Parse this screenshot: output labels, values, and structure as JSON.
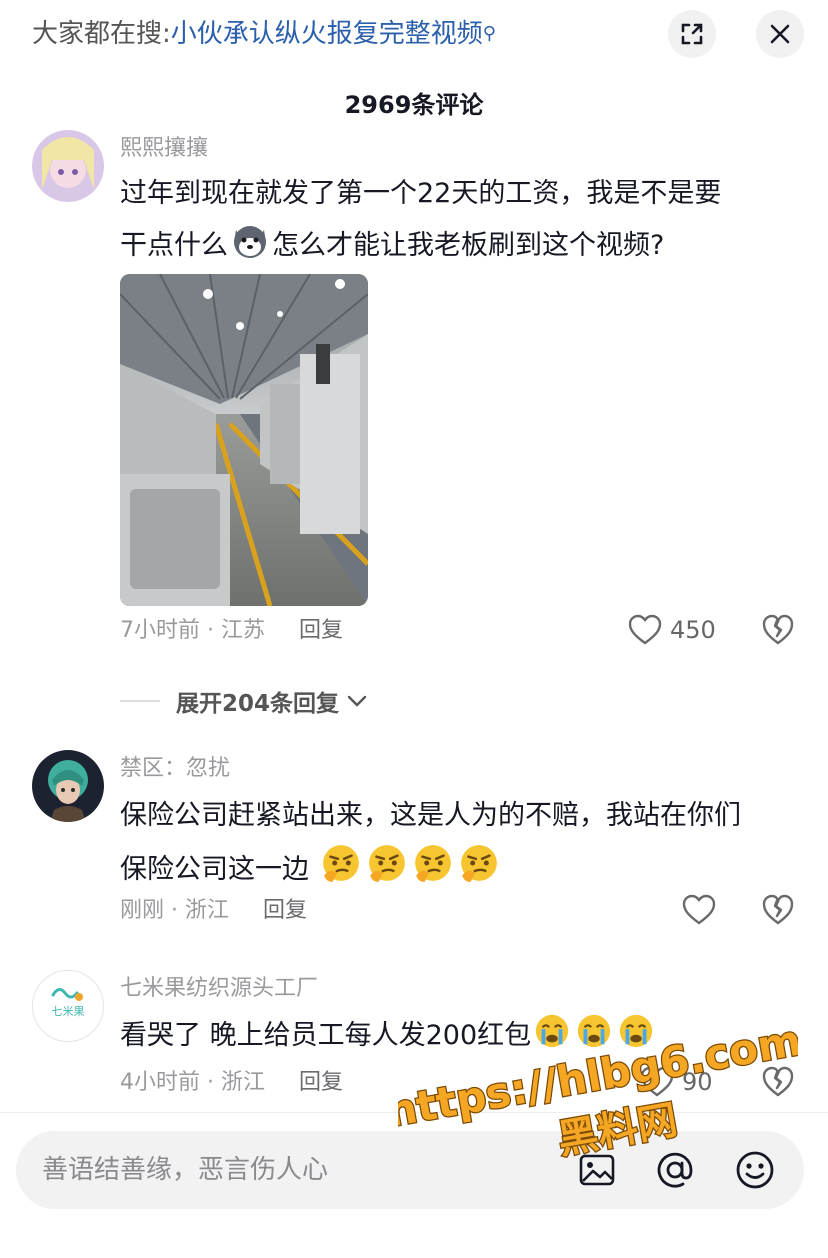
{
  "header": {
    "search_prefix": "大家都在搜:",
    "search_query": "小伙承认纵火报复完整视频",
    "search_icon": "search-icon",
    "expand_icon": "collapse-icon",
    "close_icon": "close-icon"
  },
  "comment_count": "2969条评论",
  "comments": [
    {
      "username": "熙熙攘攘",
      "text_line1": "过年到现在就发了第一个22天的工资，我是不是要",
      "text_line2_a": "干点什么",
      "text_line2_b": "怎么才能让我老板刷到这个视频?",
      "time_location": "7小时前 · 江苏",
      "reply_label": "回复",
      "likes": "450"
    },
    {
      "username": "禁区：忽扰",
      "text_line1": "保险公司赶紧站出来，这是人为的不赔，我站在你们",
      "text_line2": "保险公司这一边",
      "time_location": "刚刚 · 浙江",
      "reply_label": "回复"
    },
    {
      "username": "七米果纺织源头工厂",
      "avatar_text": "七米果",
      "text": "看哭了 晚上给员工每人发200红包",
      "time_location": "4小时前 · 浙江",
      "reply_label": "回复",
      "likes": "90"
    }
  ],
  "expand_replies": "展开204条回复",
  "input": {
    "placeholder": "善语结善缘，恶言伤人心"
  },
  "watermark": {
    "url": "https://hlbg6.com",
    "name": "黑料网"
  }
}
